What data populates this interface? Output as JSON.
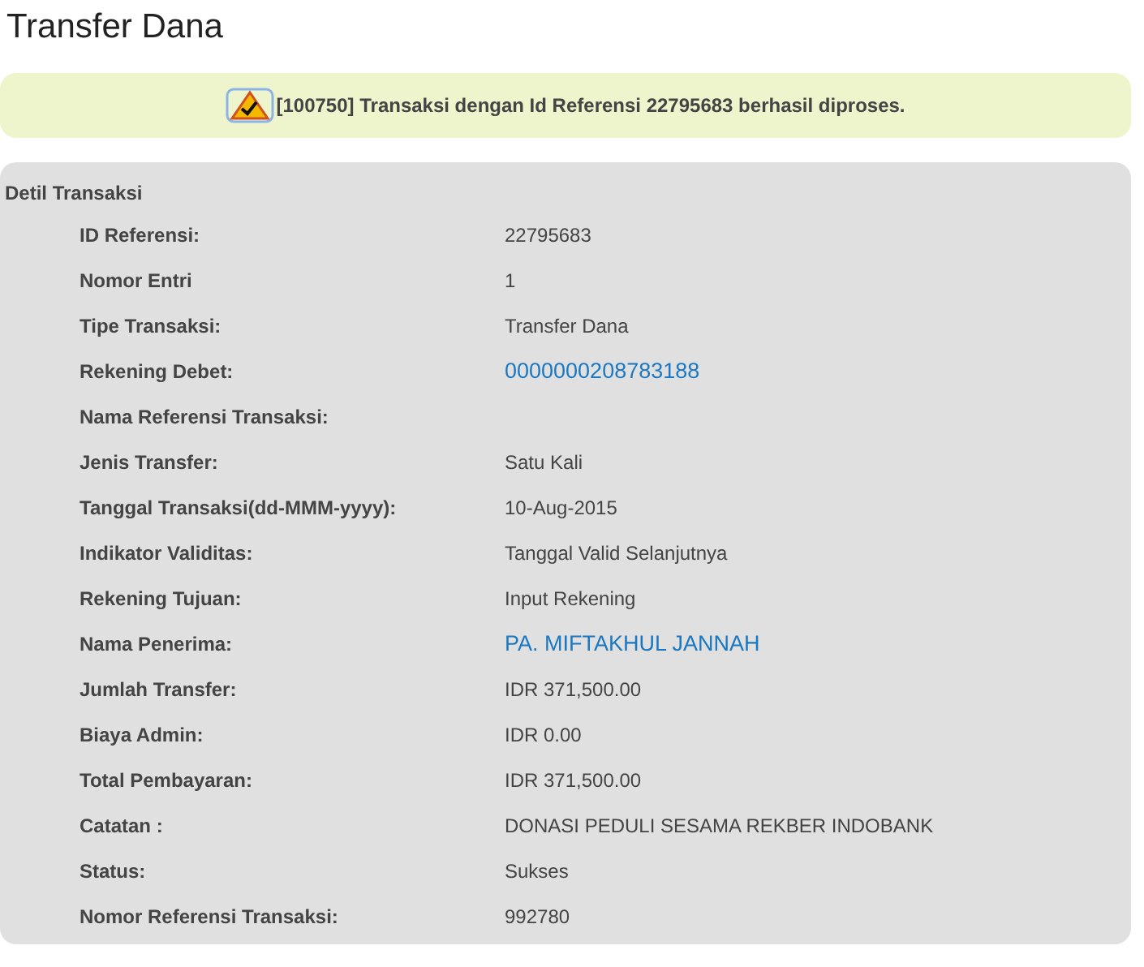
{
  "page_title": "Transfer Dana",
  "message": {
    "kind": "success",
    "text": "[100750] Transaksi dengan Id Referensi 22795683 berhasil diproses."
  },
  "details": {
    "title": "Detil Transaksi",
    "rows": [
      {
        "label": "ID Referensi:",
        "value": "22795683",
        "kind": "text"
      },
      {
        "label": "Nomor Entri",
        "value": "1",
        "kind": "text"
      },
      {
        "label": "Tipe Transaksi:",
        "value": "Transfer Dana",
        "kind": "text"
      },
      {
        "label": "Rekening Debet:",
        "value": "0000000208783188",
        "kind": "link"
      },
      {
        "label": "Nama Referensi Transaksi:"
      },
      {
        "label": "Jenis Transfer:",
        "value": "Satu Kali",
        "kind": "text"
      },
      {
        "label": "Tanggal Transaksi(dd-MMM-yyyy):",
        "value": "10-Aug-2015",
        "kind": "text"
      },
      {
        "label": "Indikator Validitas:",
        "value": "Tanggal Valid Selanjutnya",
        "kind": "text"
      },
      {
        "label": "Rekening Tujuan:",
        "value": "Input Rekening",
        "kind": "text"
      },
      {
        "label": "Nama Penerima:",
        "value": "PA. MIFTAKHUL JANNAH",
        "kind": "link"
      },
      {
        "label": "Jumlah Transfer:",
        "value": "IDR 371,500.00",
        "kind": "text"
      },
      {
        "label": "Biaya Admin:",
        "value": "IDR 0.00",
        "kind": "text"
      },
      {
        "label": "Total Pembayaran:",
        "value": "IDR 371,500.00",
        "kind": "text"
      },
      {
        "label": "Catatan :",
        "value": "DONASI PEDULI SESAMA REKBER INDOBANK",
        "kind": "text"
      },
      {
        "label": "Status:",
        "value": "Sukses",
        "kind": "text"
      },
      {
        "label": "Nomor Referensi Transaksi:",
        "value": "992780",
        "kind": "text"
      }
    ]
  }
}
